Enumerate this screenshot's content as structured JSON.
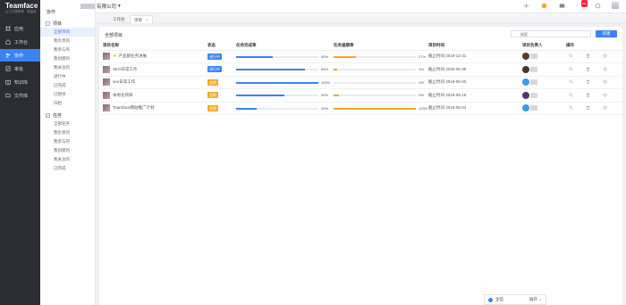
{
  "app": {
    "name": "Teamface",
    "slogan": "让工作更简单 · 更高效"
  },
  "leftnav": {
    "items": [
      {
        "label": "应用",
        "icon": "grid-icon"
      },
      {
        "label": "工作台",
        "icon": "home-icon"
      },
      {
        "label": "协作",
        "icon": "team-icon",
        "active": true
      },
      {
        "label": "审批",
        "icon": "approval-icon"
      },
      {
        "label": "知识库",
        "icon": "book-icon"
      },
      {
        "label": "文件库",
        "icon": "folder-icon"
      }
    ]
  },
  "subnav": {
    "title": "协作",
    "project_section": "项目",
    "project_items": [
      "全部项目",
      "我负责的",
      "我参与的",
      "我创建的",
      "我关注的",
      "进行中",
      "已完成",
      "已暂停",
      "归档"
    ],
    "task_section": "任务",
    "task_items": [
      "全部任务",
      "我负责的",
      "我参与的",
      "我创建的",
      "我关注的",
      "已完成"
    ]
  },
  "topbar": {
    "company": "有限公司",
    "mail_badge": "99+"
  },
  "tabs": [
    {
      "label": "工作台"
    },
    {
      "label": "项目",
      "active": true
    }
  ],
  "panel": {
    "title": "全部项目",
    "search_placeholder": "搜索",
    "new_button": "新建",
    "columns": [
      "项目名称",
      "状态",
      "任务完成率",
      "任务逾期率",
      "项目时间",
      "项目负责人",
      "操作"
    ],
    "rows": [
      {
        "name": "产品部任务进展",
        "starred": true,
        "status": "进行中",
        "status_color": "#3b82f6",
        "done": 45,
        "overdue": 27,
        "time": "截止时间 2019-12-31",
        "owner_color": "#5a3c2e"
      },
      {
        "name": "SEO日常工作",
        "starred": false,
        "status": "进行中",
        "status_color": "#3b82f6",
        "done": 84,
        "overdue": 4,
        "time": "截止时间 2020-06-30",
        "owner_color": "#4a3428"
      },
      {
        "name": "seo日常工作",
        "starred": false,
        "status": "超期",
        "status_color": "#f5a623",
        "done": 100,
        "overdue": 0,
        "time": "截止时间 2019-06-30",
        "owner_color": "#3b9be6"
      },
      {
        "name": "本地化项目",
        "starred": false,
        "status": "超期",
        "status_color": "#f5a623",
        "done": 59,
        "overdue": 6,
        "time": "截止时间 2019-06-18",
        "owner_color": "#4b3a6e"
      },
      {
        "name": "Teamface网站推广计划",
        "starred": false,
        "status": "超期",
        "status_color": "#f5a623",
        "done": 25,
        "overdue": 100,
        "time": "截止时间 2019-05-24",
        "owner_color": "#3b9be6"
      }
    ]
  },
  "chat": {
    "label": "企信",
    "expand": "展开"
  },
  "colors": {
    "blue": "#3b82f6",
    "orange": "#f5a623",
    "sidebar": "#2b2d33"
  }
}
